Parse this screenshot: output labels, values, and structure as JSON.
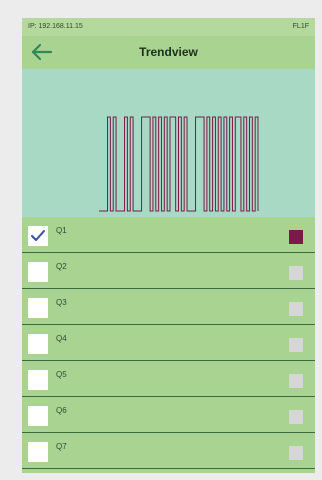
{
  "status": {
    "ip": "IP: 192.168.11.15",
    "right": "FL1F"
  },
  "header": {
    "title": "Trendview",
    "back_icon": "arrow-left-icon"
  },
  "colors": {
    "accent_back": "#2e8b57",
    "series_active": "#7a1a4a",
    "series_inactive": "#d6d6d6"
  },
  "channels": [
    {
      "label": "Q1",
      "checked": true,
      "color": "#7a1a4a"
    },
    {
      "label": "Q2",
      "checked": false,
      "color": "#d6d6d6"
    },
    {
      "label": "Q3",
      "checked": false,
      "color": "#d6d6d6"
    },
    {
      "label": "Q4",
      "checked": false,
      "color": "#d6d6d6"
    },
    {
      "label": "Q5",
      "checked": false,
      "color": "#d6d6d6"
    },
    {
      "label": "Q6",
      "checked": false,
      "color": "#d6d6d6"
    },
    {
      "label": "Q7",
      "checked": false,
      "color": "#d6d6d6"
    }
  ],
  "chart_data": {
    "type": "line",
    "series": [
      {
        "name": "Q1",
        "x": [
          0,
          2,
          3,
          4,
          5,
          6,
          8,
          9,
          10,
          11,
          12,
          14,
          15,
          17,
          18,
          19,
          20,
          21,
          22,
          23,
          24,
          25,
          27,
          28,
          29,
          30,
          31,
          33,
          34,
          36,
          37,
          38,
          39,
          40,
          41,
          42,
          43,
          44,
          45,
          46,
          47,
          48,
          50,
          51,
          52,
          53,
          54,
          55,
          56
        ],
        "y": [
          0,
          0,
          1,
          0,
          1,
          0,
          0,
          1,
          0,
          1,
          0,
          0,
          1,
          1,
          0,
          1,
          0,
          1,
          0,
          1,
          0,
          1,
          0,
          1,
          0,
          1,
          0,
          0,
          1,
          1,
          0,
          1,
          0,
          1,
          0,
          1,
          0,
          1,
          0,
          1,
          0,
          1,
          0,
          1,
          0,
          1,
          0,
          1,
          0
        ]
      }
    ],
    "ylim": [
      0,
      1
    ]
  }
}
